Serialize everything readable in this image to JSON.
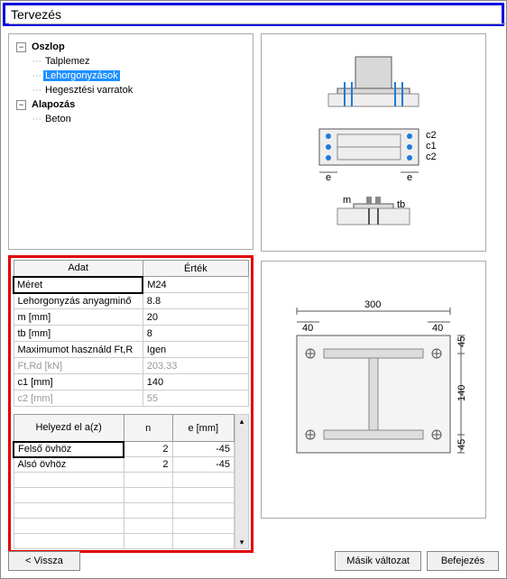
{
  "title": "Tervezés",
  "tree": {
    "node0": "Oszlop",
    "node0_0": "Talplemez",
    "node0_1": "Lehorgonyzások",
    "node0_2": "Hegesztési varratok",
    "node1": "Alapozás",
    "node1_0": "Beton"
  },
  "dataTable": {
    "header_label": "Adat",
    "header_value": "Érték",
    "rows": [
      {
        "label": "Méret",
        "value": "M24",
        "focused": true
      },
      {
        "label": "Lehorgonyzás anyagminő",
        "value": "8.8"
      },
      {
        "label": "m [mm]",
        "value": "20"
      },
      {
        "label": "tb [mm]",
        "value": "8"
      },
      {
        "label": "Maximumot használd Ft,R",
        "value": "Igen"
      },
      {
        "label": "Ft,Rd [kN]",
        "value": "203.33",
        "disabled": true
      },
      {
        "label": "c1 [mm]",
        "value": "140"
      },
      {
        "label": "c2 [mm]",
        "value": "55",
        "disabled": true
      }
    ]
  },
  "posTable": {
    "header_pos": "Helyezd el a(z)",
    "header_n": "n",
    "header_e": "e\n[mm]",
    "rows": [
      {
        "pos": "Felső övhöz",
        "n": "2",
        "e": "-45",
        "focused": true
      },
      {
        "pos": "Alsó övhöz",
        "n": "2",
        "e": "-45"
      }
    ]
  },
  "buttons": {
    "back": "< Vissza",
    "alt": "Másik változat",
    "finish": "Befejezés"
  },
  "dims": {
    "top_width": "300",
    "edge": "40",
    "side_c": "140",
    "side_e": "45"
  },
  "labels": {
    "c1": "c1",
    "c2": "c2",
    "e": "e",
    "m": "m",
    "tb": "tb"
  }
}
